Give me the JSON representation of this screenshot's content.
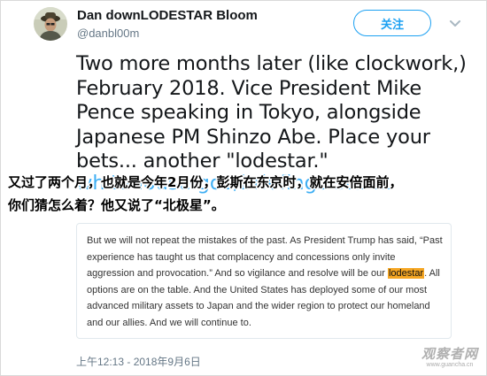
{
  "user": {
    "display_name": "Dan downLODESTAR Bloom",
    "handle": "@danbl00m"
  },
  "follow_button": {
    "label": "关注"
  },
  "tweet": {
    "lines": [
      "Two more months later (like clockwork,)",
      "February 2018. Vice President Mike",
      "Pence speaking in Tokyo, alongside",
      "Japanese PM Shinzo Abe. Place your",
      "bets... another \"lodestar.\""
    ],
    "link": "whitehouse.gov/briefings-stat..."
  },
  "subtitle": {
    "lines": [
      "又过了两个月，也就是今年2月份，彭斯在东京时，就在安倍面前，",
      "你们猜怎么着？他又说了“北极星”。"
    ]
  },
  "quote": {
    "lines": [
      [
        "But we will not repeat the mistakes of the past. As President Trump has said, “Past"
      ],
      [
        "experience has taught us that complacency and concessions only invite"
      ],
      [
        "aggression and provocation.” And so vigilance and resolve will be our ",
        "lodestar",
        ". All"
      ],
      [
        "options are on the table. And the United States has deployed some of our most"
      ],
      [
        "advanced military assets to Japan and the wider region to protect our homeland"
      ],
      [
        "and our allies. And we will continue to."
      ]
    ]
  },
  "timestamp": "上午12:13 - 2018年9月6日",
  "watermark": {
    "main": "观察者网",
    "sub": "www.guancha.cn"
  },
  "colors": {
    "accent": "#1da1f2",
    "highlight": "#f5a623",
    "muted": "#657786"
  },
  "icons": {
    "avatar": "profile-avatar",
    "menu": "chevron-down-icon"
  }
}
